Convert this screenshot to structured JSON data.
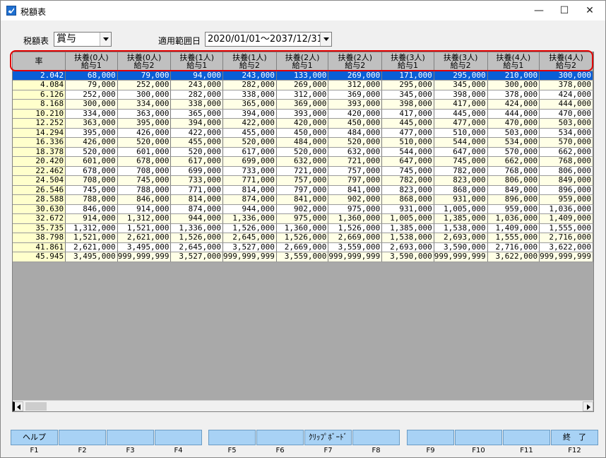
{
  "window": {
    "title": "税額表",
    "minimize": "—",
    "maximize": "☐",
    "close": "✕"
  },
  "filters": {
    "table_label": "税額表",
    "table_value": "賞与",
    "range_label": "適用範囲日",
    "range_value": "2020/01/01〜2037/12/31"
  },
  "grid": {
    "headers": [
      [
        "率",
        ""
      ],
      [
        "扶養(0人)",
        "給与1"
      ],
      [
        "扶養(0人)",
        "給与2"
      ],
      [
        "扶養(1人)",
        "給与1"
      ],
      [
        "扶養(1人)",
        "給与2"
      ],
      [
        "扶養(2人)",
        "給与1"
      ],
      [
        "扶養(2人)",
        "給与2"
      ],
      [
        "扶養(3人)",
        "給与1"
      ],
      [
        "扶養(3人)",
        "給与2"
      ],
      [
        "扶養(4人)",
        "給与1"
      ],
      [
        "扶養(4人)",
        "給与2"
      ]
    ],
    "rows": [
      [
        "2.042",
        "68,000",
        "79,000",
        "94,000",
        "243,000",
        "133,000",
        "269,000",
        "171,000",
        "295,000",
        "210,000",
        "300,000"
      ],
      [
        "4.084",
        "79,000",
        "252,000",
        "243,000",
        "282,000",
        "269,000",
        "312,000",
        "295,000",
        "345,000",
        "300,000",
        "378,000"
      ],
      [
        "6.126",
        "252,000",
        "300,000",
        "282,000",
        "338,000",
        "312,000",
        "369,000",
        "345,000",
        "398,000",
        "378,000",
        "424,000"
      ],
      [
        "8.168",
        "300,000",
        "334,000",
        "338,000",
        "365,000",
        "369,000",
        "393,000",
        "398,000",
        "417,000",
        "424,000",
        "444,000"
      ],
      [
        "10.210",
        "334,000",
        "363,000",
        "365,000",
        "394,000",
        "393,000",
        "420,000",
        "417,000",
        "445,000",
        "444,000",
        "470,000"
      ],
      [
        "12.252",
        "363,000",
        "395,000",
        "394,000",
        "422,000",
        "420,000",
        "450,000",
        "445,000",
        "477,000",
        "470,000",
        "503,000"
      ],
      [
        "14.294",
        "395,000",
        "426,000",
        "422,000",
        "455,000",
        "450,000",
        "484,000",
        "477,000",
        "510,000",
        "503,000",
        "534,000"
      ],
      [
        "16.336",
        "426,000",
        "520,000",
        "455,000",
        "520,000",
        "484,000",
        "520,000",
        "510,000",
        "544,000",
        "534,000",
        "570,000"
      ],
      [
        "18.378",
        "520,000",
        "601,000",
        "520,000",
        "617,000",
        "520,000",
        "632,000",
        "544,000",
        "647,000",
        "570,000",
        "662,000"
      ],
      [
        "20.420",
        "601,000",
        "678,000",
        "617,000",
        "699,000",
        "632,000",
        "721,000",
        "647,000",
        "745,000",
        "662,000",
        "768,000"
      ],
      [
        "22.462",
        "678,000",
        "708,000",
        "699,000",
        "733,000",
        "721,000",
        "757,000",
        "745,000",
        "782,000",
        "768,000",
        "806,000"
      ],
      [
        "24.504",
        "708,000",
        "745,000",
        "733,000",
        "771,000",
        "757,000",
        "797,000",
        "782,000",
        "823,000",
        "806,000",
        "849,000"
      ],
      [
        "26.546",
        "745,000",
        "788,000",
        "771,000",
        "814,000",
        "797,000",
        "841,000",
        "823,000",
        "868,000",
        "849,000",
        "896,000"
      ],
      [
        "28.588",
        "788,000",
        "846,000",
        "814,000",
        "874,000",
        "841,000",
        "902,000",
        "868,000",
        "931,000",
        "896,000",
        "959,000"
      ],
      [
        "30.630",
        "846,000",
        "914,000",
        "874,000",
        "944,000",
        "902,000",
        "975,000",
        "931,000",
        "1,005,000",
        "959,000",
        "1,036,000"
      ],
      [
        "32.672",
        "914,000",
        "1,312,000",
        "944,000",
        "1,336,000",
        "975,000",
        "1,360,000",
        "1,005,000",
        "1,385,000",
        "1,036,000",
        "1,409,000"
      ],
      [
        "35.735",
        "1,312,000",
        "1,521,000",
        "1,336,000",
        "1,526,000",
        "1,360,000",
        "1,526,000",
        "1,385,000",
        "1,538,000",
        "1,409,000",
        "1,555,000"
      ],
      [
        "38.798",
        "1,521,000",
        "2,621,000",
        "1,526,000",
        "2,645,000",
        "1,526,000",
        "2,669,000",
        "1,538,000",
        "2,693,000",
        "1,555,000",
        "2,716,000"
      ],
      [
        "41.861",
        "2,621,000",
        "3,495,000",
        "2,645,000",
        "3,527,000",
        "2,669,000",
        "3,559,000",
        "2,693,000",
        "3,590,000",
        "2,716,000",
        "3,622,000"
      ],
      [
        "45.945",
        "3,495,000",
        "999,999,999",
        "3,527,000",
        "999,999,999",
        "3,559,000",
        "999,999,999",
        "3,590,000",
        "999,999,999",
        "3,622,000",
        "999,999,999"
      ]
    ]
  },
  "fkeys": [
    {
      "key": "F1",
      "label": "ヘルプ"
    },
    {
      "key": "F2",
      "label": ""
    },
    {
      "key": "F3",
      "label": ""
    },
    {
      "key": "F4",
      "label": ""
    },
    {
      "key": "F5",
      "label": ""
    },
    {
      "key": "F6",
      "label": ""
    },
    {
      "key": "F7",
      "label": "ｸﾘｯﾌﾟﾎﾞｰﾄﾞ"
    },
    {
      "key": "F8",
      "label": ""
    },
    {
      "key": "F9",
      "label": ""
    },
    {
      "key": "F10",
      "label": ""
    },
    {
      "key": "F11",
      "label": ""
    },
    {
      "key": "F12",
      "label": "終　了"
    }
  ]
}
